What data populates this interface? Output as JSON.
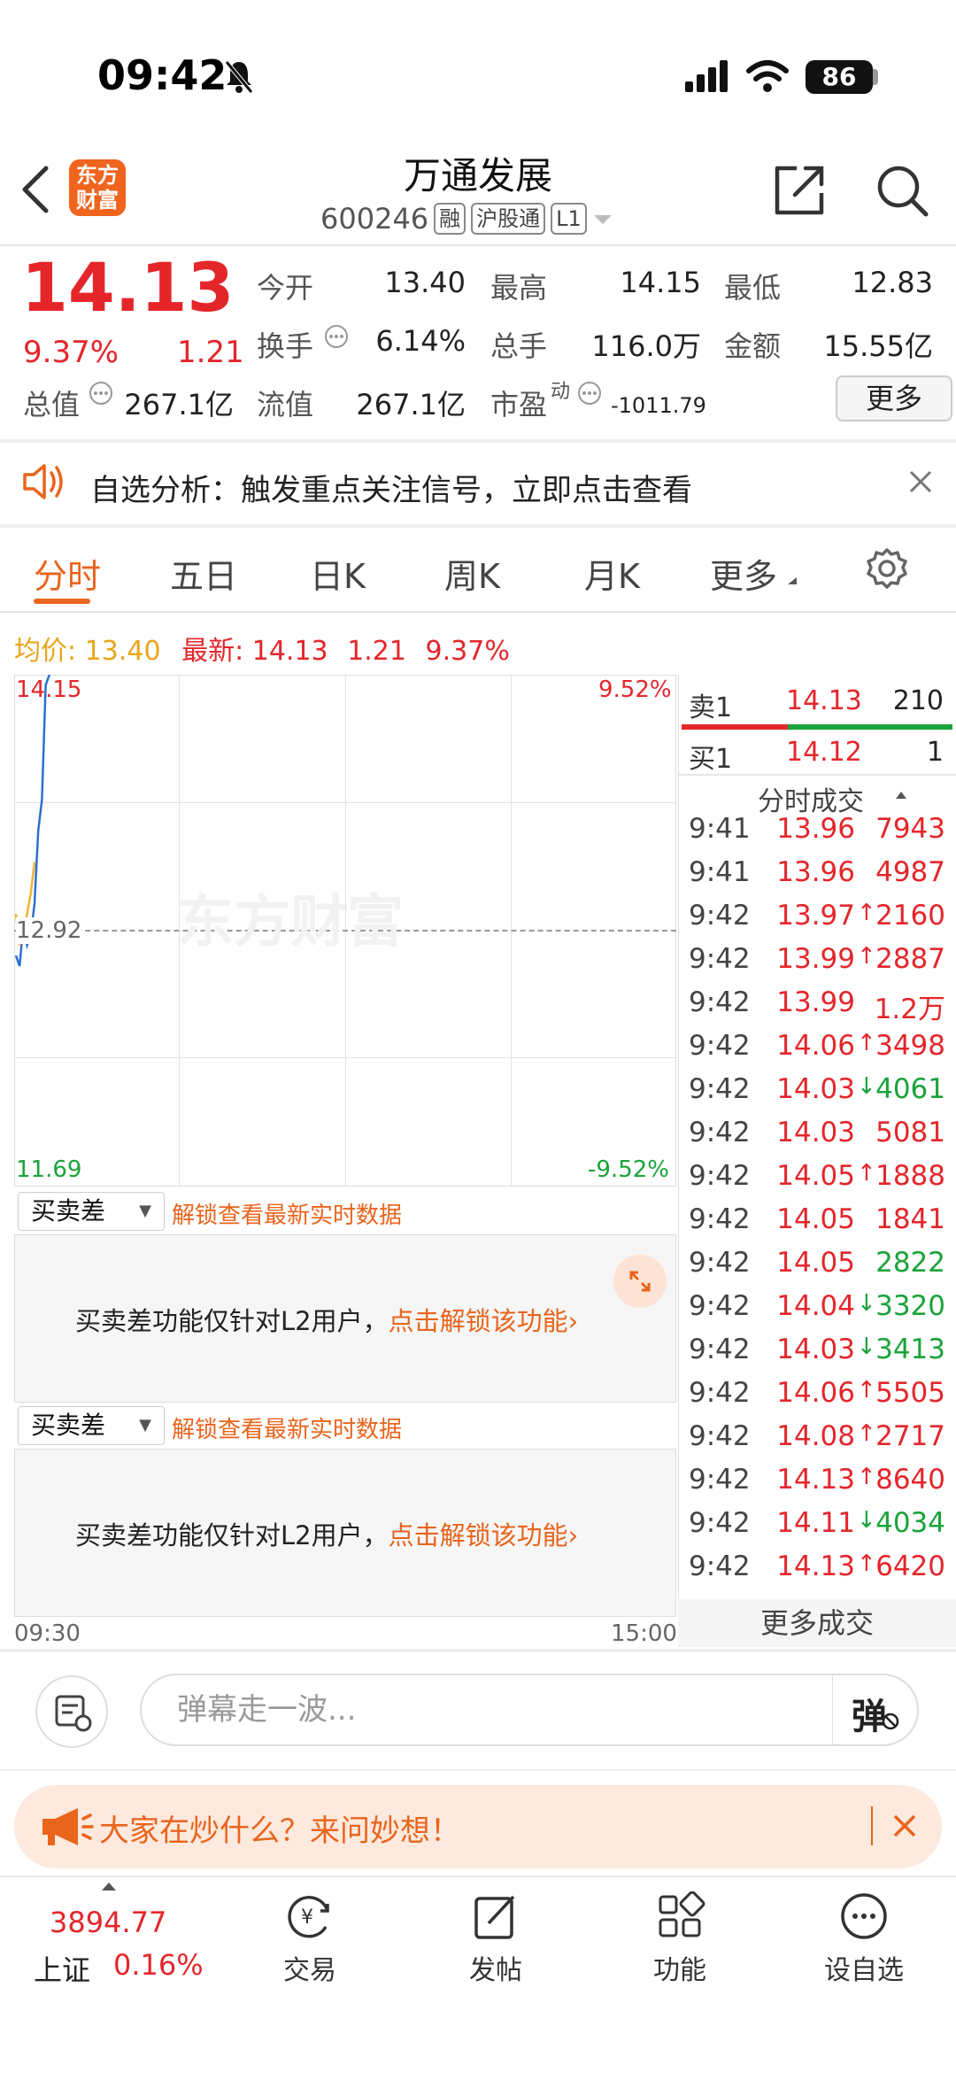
{
  "status": {
    "time": "09:42",
    "battery": "86"
  },
  "header": {
    "logo_text": "东方财富",
    "stock_name": "万通发展",
    "stock_code": "600246",
    "tags": [
      "融",
      "沪股通",
      "L1"
    ]
  },
  "quote": {
    "price": "14.13",
    "change_pct": "9.37%",
    "change": "1.21",
    "fields": [
      {
        "label": "今开",
        "value": "13.40"
      },
      {
        "label": "最高",
        "value": "14.15"
      },
      {
        "label": "最低",
        "value": "12.83"
      },
      {
        "label": "换手",
        "value": "6.14%"
      },
      {
        "label": "总手",
        "value": "116.0万"
      },
      {
        "label": "金额",
        "value": "15.55亿"
      },
      {
        "label": "总值",
        "value": "267.1亿"
      },
      {
        "label": "流值",
        "value": "267.1亿"
      },
      {
        "label": "市盈",
        "sup": "动",
        "value": "-1011.79"
      }
    ],
    "more_label": "更多"
  },
  "notice": {
    "text": "自选分析：触发重点关注信号，立即点击查看"
  },
  "tabs": [
    "分时",
    "五日",
    "日K",
    "周K",
    "月K",
    "更多"
  ],
  "summary": {
    "avg_label": "均价:",
    "avg_value": "13.40",
    "latest_label": "最新:",
    "latest_price": "14.13",
    "latest_change": "1.21",
    "latest_pct": "9.37%"
  },
  "chart_data": {
    "type": "line",
    "y_top_label": "14.15",
    "y_mid_label": "12.92",
    "y_bottom_label": "11.69",
    "pct_top_label": "9.52%",
    "pct_bottom_label": "-9.52%",
    "x_start_label": "09:30",
    "x_end_label": "15:00",
    "ylim": [
      11.69,
      14.15
    ],
    "series": [
      {
        "values": [
          12.8,
          12.75,
          12.95,
          12.85,
          12.9,
          13.05,
          13.4,
          13.55,
          14.1,
          14.15
        ]
      },
      {
        "values": [
          13.0,
          12.85,
          12.9,
          13.0,
          13.1,
          13.25
        ]
      }
    ]
  },
  "order_book": {
    "sell1_label": "卖1",
    "sell1_price": "14.13",
    "sell1_volume": "210",
    "buy1_label": "买1",
    "buy1_price": "14.12",
    "buy1_volume": "1",
    "trades_header": "分时成交",
    "trades": [
      {
        "time": "9:41",
        "price": "13.96",
        "vol": "7943",
        "arrow": "",
        "color": "red"
      },
      {
        "time": "9:41",
        "price": "13.96",
        "vol": "4987",
        "arrow": "",
        "color": "red"
      },
      {
        "time": "9:42",
        "price": "13.97",
        "vol": "2160",
        "arrow": "↑",
        "color": "red"
      },
      {
        "time": "9:42",
        "price": "13.99",
        "vol": "2887",
        "arrow": "↑",
        "color": "red"
      },
      {
        "time": "9:42",
        "price": "13.99",
        "vol": "1.2万",
        "arrow": "",
        "color": "red"
      },
      {
        "time": "9:42",
        "price": "14.06",
        "vol": "3498",
        "arrow": "↑",
        "color": "red"
      },
      {
        "time": "9:42",
        "price": "14.03",
        "vol": "4061",
        "arrow": "↓",
        "color": "green"
      },
      {
        "time": "9:42",
        "price": "14.03",
        "vol": "5081",
        "arrow": "",
        "color": "red"
      },
      {
        "time": "9:42",
        "price": "14.05",
        "vol": "1888",
        "arrow": "↑",
        "color": "red"
      },
      {
        "time": "9:42",
        "price": "14.05",
        "vol": "1841",
        "arrow": "",
        "color": "red"
      },
      {
        "time": "9:42",
        "price": "14.05",
        "vol": "2822",
        "arrow": "",
        "color": "green"
      },
      {
        "time": "9:42",
        "price": "14.04",
        "vol": "3320",
        "arrow": "↓",
        "color": "green"
      },
      {
        "time": "9:42",
        "price": "14.03",
        "vol": "3413",
        "arrow": "↓",
        "color": "green"
      },
      {
        "time": "9:42",
        "price": "14.06",
        "vol": "5505",
        "arrow": "↑",
        "color": "red"
      },
      {
        "time": "9:42",
        "price": "14.08",
        "vol": "2717",
        "arrow": "↑",
        "color": "red"
      },
      {
        "time": "9:42",
        "price": "14.13",
        "vol": "8640",
        "arrow": "↑",
        "color": "red"
      },
      {
        "time": "9:42",
        "price": "14.11",
        "vol": "4034",
        "arrow": "↓",
        "color": "green"
      },
      {
        "time": "9:42",
        "price": "14.13",
        "vol": "6420",
        "arrow": "↑",
        "color": "red"
      }
    ],
    "more_trades": "更多成交"
  },
  "diff_panel": {
    "select_label": "买卖差",
    "unlock_hint": "解锁查看最新实时数据",
    "message": "买卖差功能仅针对L2用户，",
    "unlock_link": "点击解锁该功能"
  },
  "watermark": "东方财富",
  "comment": {
    "placeholder": "弹幕走一波...",
    "danmu_label": "弹"
  },
  "promo": {
    "text": "大家在炒什么？来问妙想！"
  },
  "bottom_nav": {
    "index_value": "3894.77",
    "index_name": "上证",
    "index_pct": "0.16%",
    "items": [
      "交易",
      "发帖",
      "功能",
      "设自选"
    ]
  },
  "colors": {
    "up": "#e4262b",
    "down": "#1aa33a",
    "accent": "#e9641c"
  }
}
